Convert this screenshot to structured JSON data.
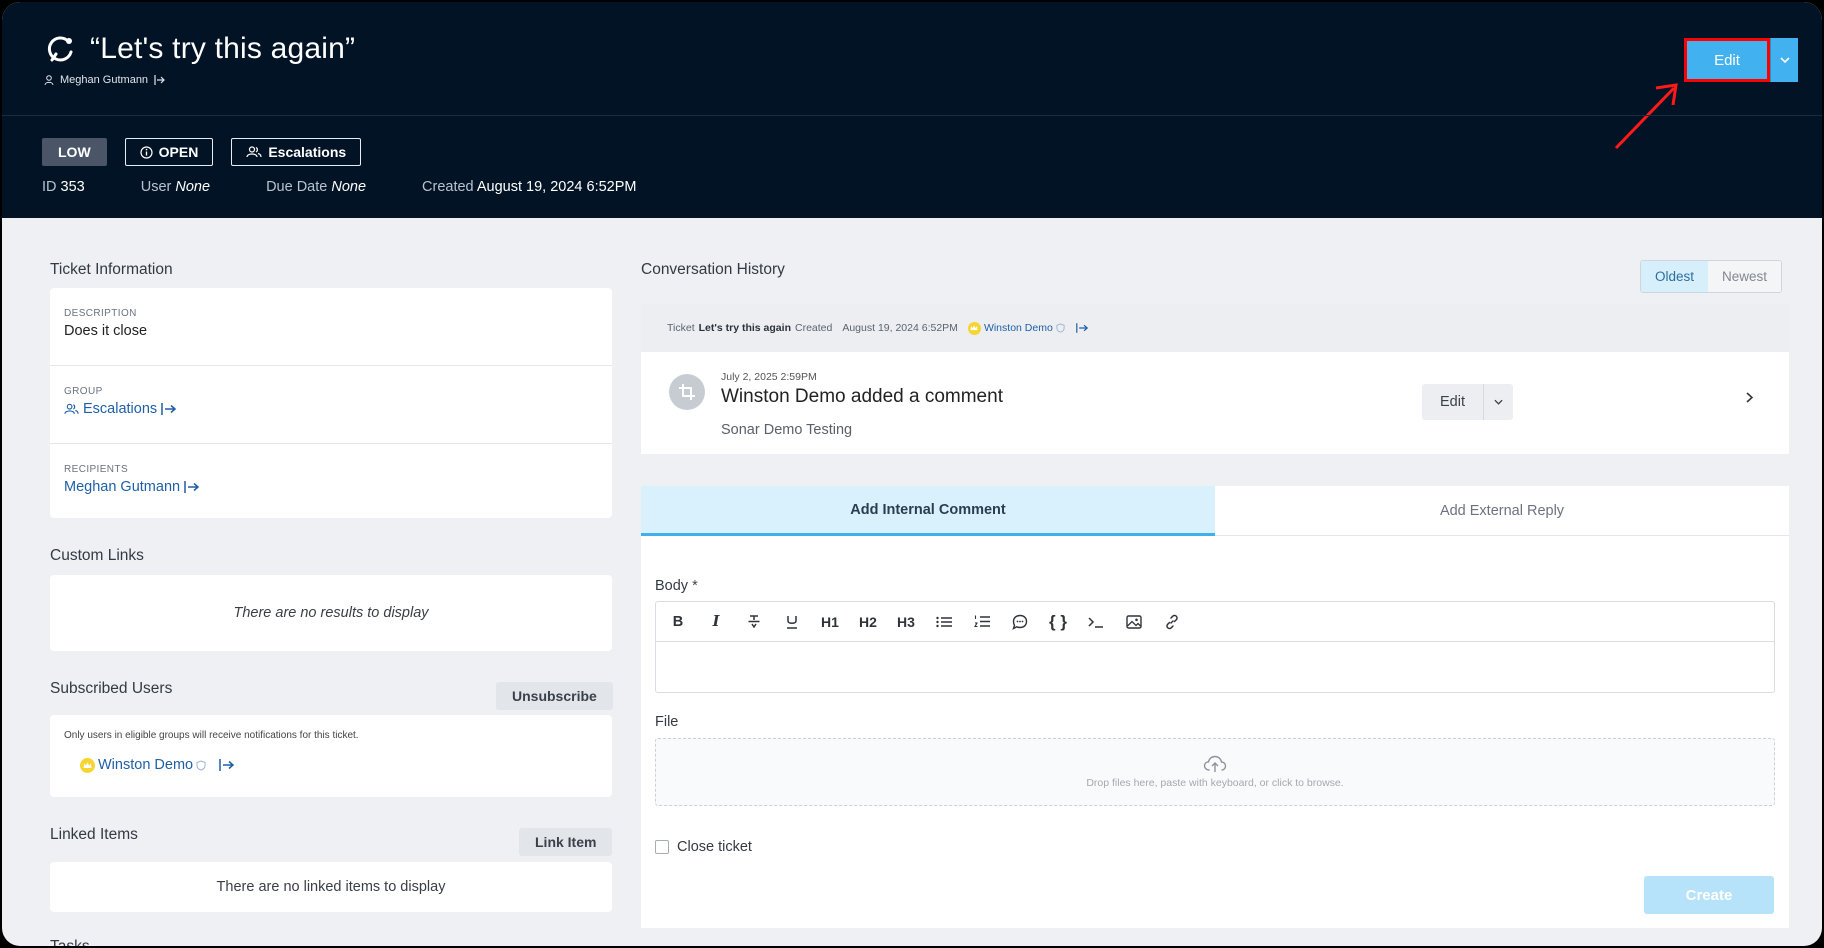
{
  "header": {
    "title": "“Let's try this again”",
    "owner": "Meghan Gutmann",
    "badges": {
      "priority": "LOW",
      "status": "OPEN",
      "group": "Escalations"
    },
    "meta": {
      "id_label": "ID",
      "id_value": "353",
      "user_label": "User",
      "user_value": "None",
      "due_label": "Due Date",
      "due_value": "None",
      "created_label": "Created",
      "created_value": "August 19, 2024 6:52PM"
    },
    "edit_label": "Edit"
  },
  "ticket_info": {
    "heading": "Ticket Information",
    "description_label": "DESCRIPTION",
    "description_value": "Does it close",
    "group_label": "GROUP",
    "group_value": "Escalations",
    "recipients_label": "RECIPIENTS",
    "recipients_value": "Meghan Gutmann"
  },
  "custom_links": {
    "heading": "Custom Links",
    "empty": "There are no results to display"
  },
  "subscribed": {
    "heading": "Subscribed Users",
    "unsubscribe_label": "Unsubscribe",
    "note": "Only users in eligible groups will receive notifications for this ticket.",
    "user": "Winston Demo"
  },
  "linked": {
    "heading": "Linked Items",
    "button": "Link Item",
    "empty": "There are no linked items to display"
  },
  "tasks_heading": "Tasks",
  "conversation": {
    "heading": "Conversation History",
    "sort_oldest": "Oldest",
    "sort_newest": "Newest",
    "history": {
      "prefix": "Ticket",
      "ticket": "Let's try this again",
      "action": "Created",
      "date": "August 19, 2024 6:52PM",
      "user": "Winston Demo"
    },
    "comment": {
      "date": "July 2, 2025 2:59PM",
      "title": "Winston Demo added a comment",
      "body": "Sonar Demo Testing",
      "edit_label": "Edit"
    }
  },
  "composer": {
    "tab_internal": "Add Internal Comment",
    "tab_external": "Add External Reply",
    "body_label": "Body",
    "required_mark": "*",
    "toolbar": {
      "h1": "H1",
      "h2": "H2",
      "h3": "H3",
      "bold": "B",
      "italic": "I",
      "code": "{ }"
    },
    "file_label": "File",
    "drop_text": "Drop files here, paste with keyboard, or click to browse.",
    "close_label": "Close ticket",
    "create_label": "Create"
  },
  "colors": {
    "header_bg": "#031326",
    "accent": "#42b1ef",
    "link": "#1f5fa7",
    "highlight": "#ff0000"
  }
}
